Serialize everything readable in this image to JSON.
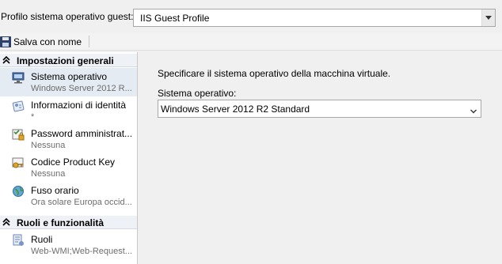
{
  "profile": {
    "label": "Profilo sistema operativo guest:",
    "selected": "IIS Guest Profile"
  },
  "toolbar": {
    "save_label": "Salva con nome"
  },
  "sidebar": {
    "sections": [
      {
        "title": "Impostazioni generali",
        "items": [
          {
            "title": "Sistema operativo",
            "subtitle": "Windows Server 2012 R...",
            "icon": "computer-icon"
          },
          {
            "title": "Informazioni di identità",
            "subtitle": "*",
            "icon": "id-card-icon"
          },
          {
            "title": "Password amministrat...",
            "subtitle": "Nessuna",
            "icon": "password-icon"
          },
          {
            "title": "Codice Product Key",
            "subtitle": "Nessuna",
            "icon": "product-key-icon"
          },
          {
            "title": "Fuso orario",
            "subtitle": "Ora solare Europa occid...",
            "icon": "globe-icon"
          }
        ]
      },
      {
        "title": "Ruoli e funzionalità",
        "items": [
          {
            "title": "Ruoli",
            "subtitle": "Web-WMI;Web-Request...",
            "icon": "roles-icon"
          }
        ]
      }
    ]
  },
  "main": {
    "instruction": "Specificare il sistema operativo della macchina virtuale.",
    "os_label": "Sistema operativo:",
    "os_value": "Windows Server 2012 R2 Standard"
  }
}
